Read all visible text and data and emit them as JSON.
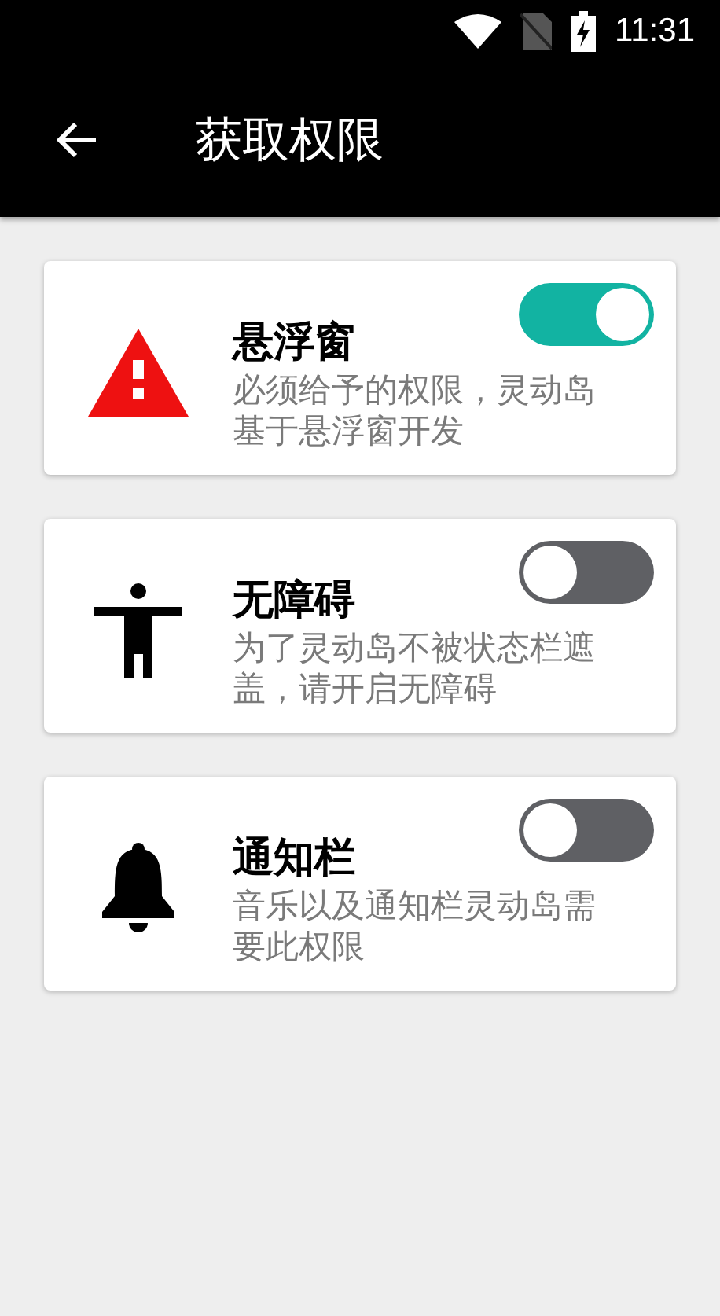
{
  "status_bar": {
    "time": "11:31"
  },
  "app_bar": {
    "title": "获取权限"
  },
  "permissions": [
    {
      "kind": "warning",
      "title": "悬浮窗",
      "description": "必须给予的权限，灵动岛基于悬浮窗开发",
      "on": true
    },
    {
      "kind": "accessibility",
      "title": "无障碍",
      "description": "为了灵动岛不被状态栏遮盖，请开启无障碍",
      "on": false
    },
    {
      "kind": "bell",
      "title": "通知栏",
      "description": "音乐以及通知栏灵动岛需要此权限",
      "on": false
    }
  ]
}
